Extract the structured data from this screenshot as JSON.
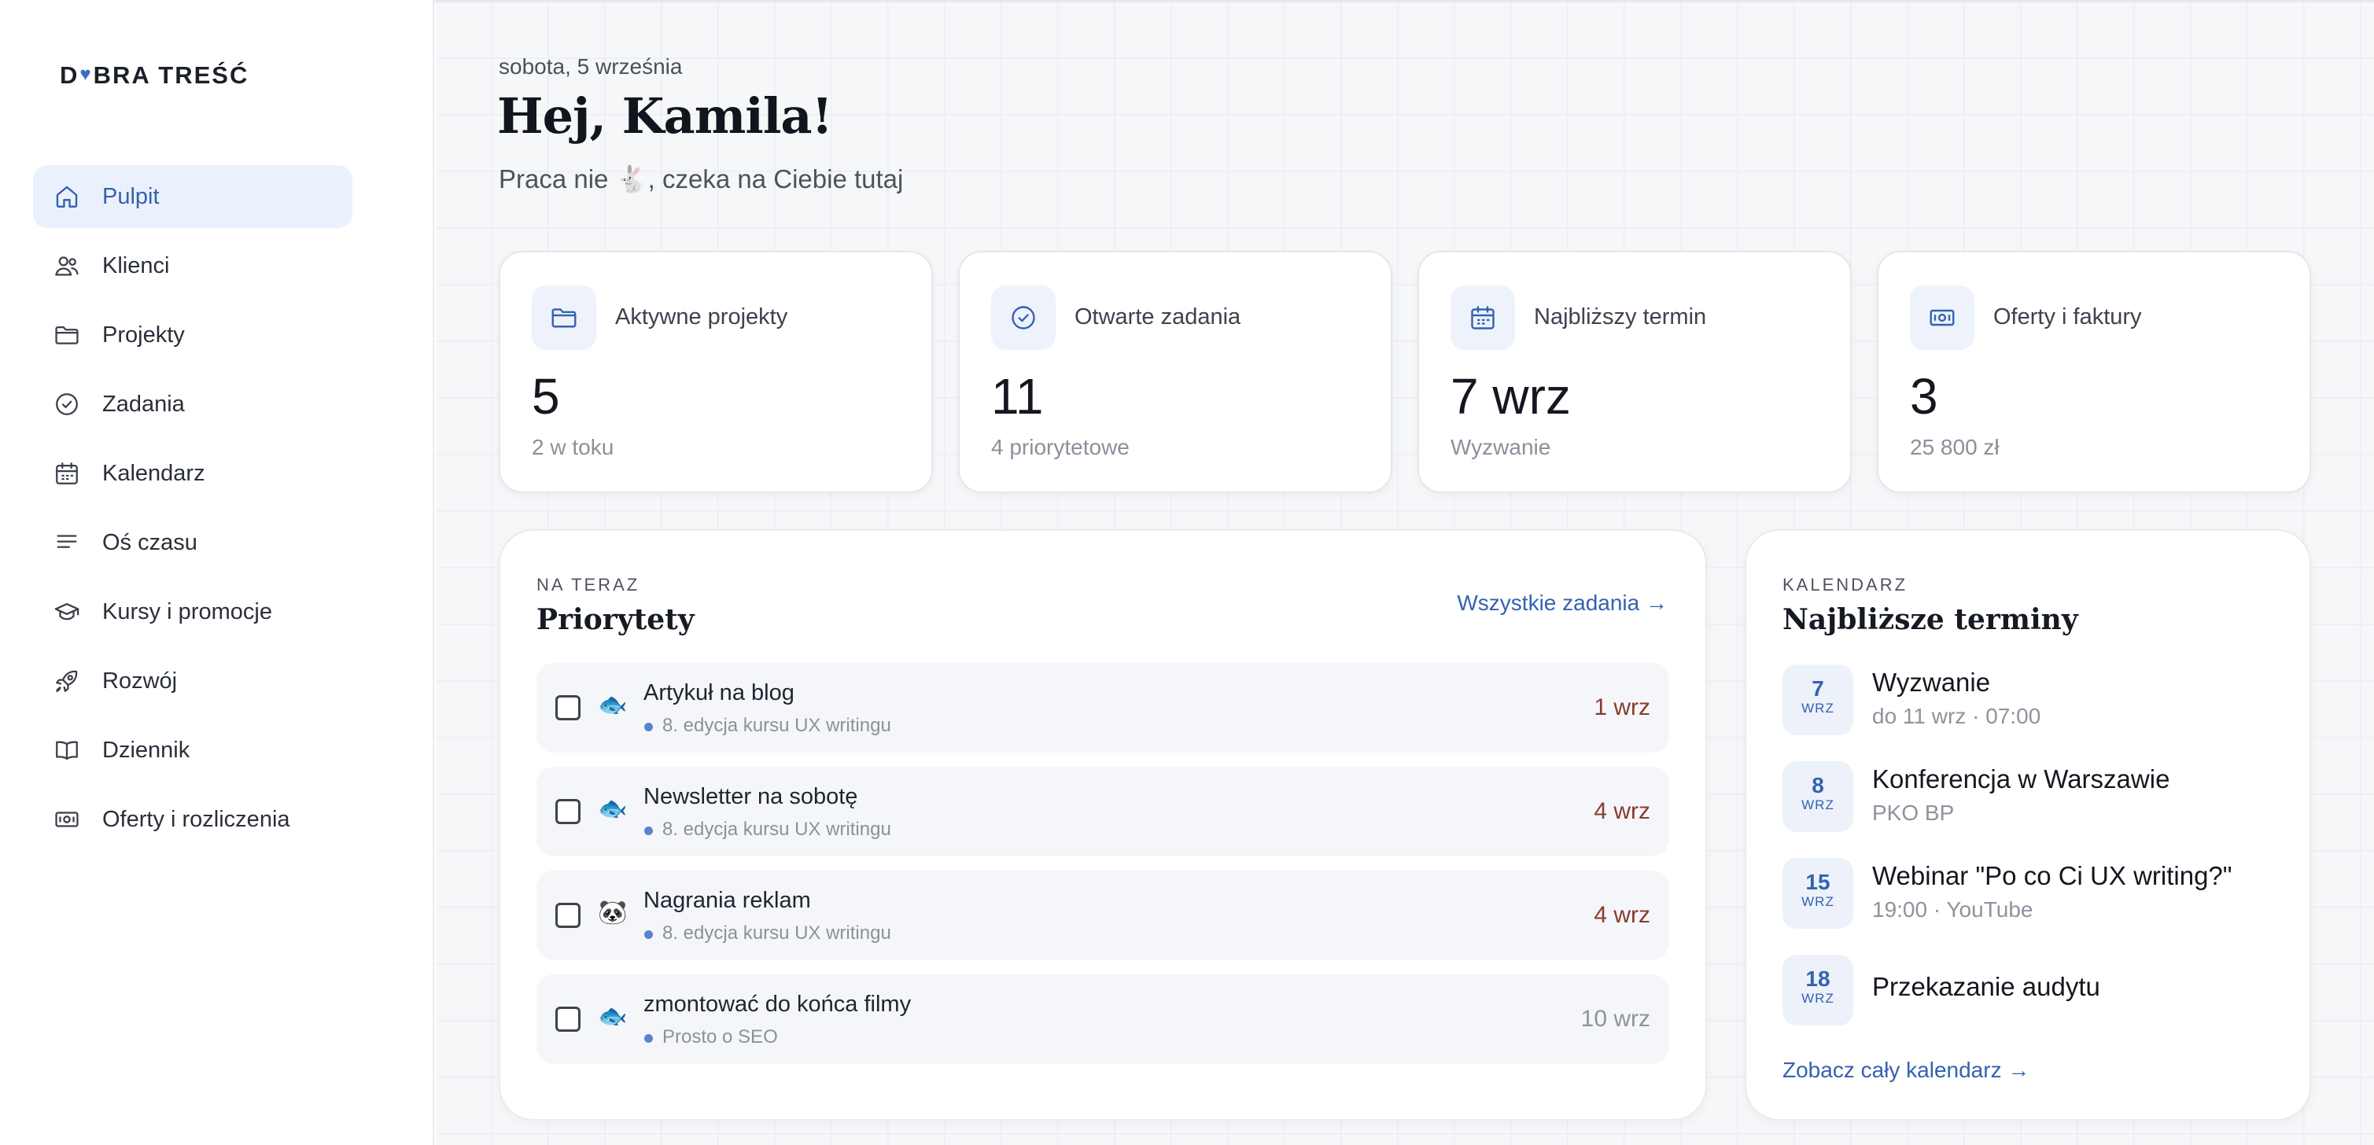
{
  "sidebar": {
    "logo_left": "D",
    "logo_heart": "♥",
    "logo_right": "BRA TREŚĆ",
    "items": [
      {
        "label": "Pulpit",
        "icon": "home-icon",
        "active": true
      },
      {
        "label": "Klienci",
        "icon": "users-icon"
      },
      {
        "label": "Projekty",
        "icon": "folder-icon"
      },
      {
        "label": "Zadania",
        "icon": "check-circle-icon"
      },
      {
        "label": "Kalendarz",
        "icon": "calendar-icon"
      },
      {
        "label": "Oś czasu",
        "icon": "lines-icon"
      },
      {
        "label": "Kursy i promocje",
        "icon": "graduation-cap-icon"
      },
      {
        "label": "Rozwój",
        "icon": "rocket-icon"
      },
      {
        "label": "Dziennik",
        "icon": "book-icon"
      },
      {
        "label": "Oferty i rozliczenia",
        "icon": "money-icon"
      }
    ]
  },
  "header": {
    "date": "sobota, 5 września",
    "greeting": "Hej, Kamila!",
    "subtitle": "Praca nie 🐇, czeka na Ciebie tutaj"
  },
  "stats": [
    {
      "label": "Aktywne projekty",
      "value": "5",
      "sub": "2 w toku",
      "icon": "folder-icon"
    },
    {
      "label": "Otwarte zadania",
      "value": "11",
      "sub": "4 priorytetowe",
      "icon": "check-circle-icon"
    },
    {
      "label": "Najbliższy termin",
      "value": "7 wrz",
      "sub": "Wyzwanie",
      "icon": "calendar-icon"
    },
    {
      "label": "Oferty i faktury",
      "value": "3",
      "sub": "25 800 zł",
      "icon": "money-icon"
    }
  ],
  "priorities": {
    "eyebrow": "NA TERAZ",
    "title": "Priorytety",
    "link": "Wszystkie zadania →",
    "tasks": [
      {
        "title": "Artykuł na blog",
        "project": "8. edycja kursu UX writingu",
        "date": "1 wrz",
        "emoji": "🐟",
        "overdue": true
      },
      {
        "title": "Newsletter na sobotę",
        "project": "8. edycja kursu UX writingu",
        "date": "4 wrz",
        "emoji": "🐟",
        "overdue": true
      },
      {
        "title": "Nagrania reklam",
        "project": "8. edycja kursu UX writingu",
        "date": "4 wrz",
        "emoji": "🐼",
        "overdue": true
      },
      {
        "title": "zmontować do końca filmy",
        "project": "Prosto o SEO",
        "date": "10 wrz",
        "emoji": "🐟",
        "overdue": false
      }
    ]
  },
  "calendar": {
    "eyebrow": "KALENDARZ",
    "title": "Najbliższe terminy",
    "link": "Zobacz cały kalendarz →",
    "events": [
      {
        "day": "7",
        "month": "WRZ",
        "title": "Wyzwanie",
        "sub": "do 11 wrz · 07:00"
      },
      {
        "day": "8",
        "month": "WRZ",
        "title": "Konferencja w Warszawie",
        "sub": "PKO BP"
      },
      {
        "day": "15",
        "month": "WRZ",
        "title": "Webinar \"Po co Ci UX writing?\"",
        "sub": "19:00 · YouTube"
      },
      {
        "day": "18",
        "month": "WRZ",
        "title": "Przekazanie audytu",
        "sub": ""
      }
    ]
  },
  "colors": {
    "accent": "#3562b0",
    "overdue": "#8a3a2f",
    "active_bg": "#ebf1fc"
  }
}
